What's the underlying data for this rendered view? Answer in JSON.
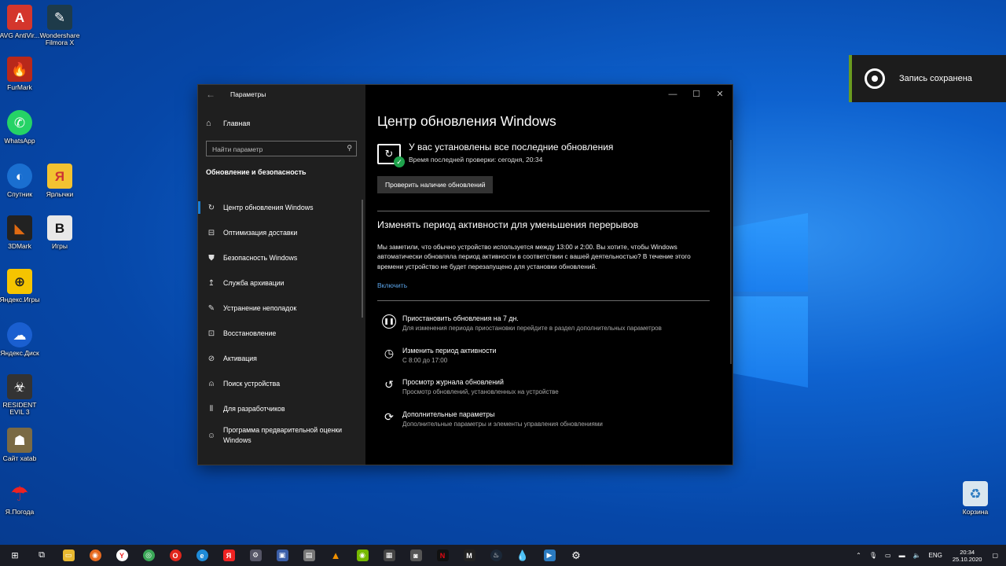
{
  "desktop_icons": [
    {
      "label": "AVG AntiVir...",
      "icon": "avg-icon",
      "color": "#d4362c"
    },
    {
      "label": "Wondershare Filmora X",
      "icon": "filmora-icon",
      "color": "#1e3b4a"
    },
    {
      "label": "FurMark",
      "icon": "furmark-icon",
      "color": "#b8281a"
    },
    {
      "label": "WhatsApp",
      "icon": "whatsapp-icon",
      "color": "#25d366"
    },
    {
      "label": "Спутник",
      "icon": "sputnik-icon",
      "color": "#1a6fd0"
    },
    {
      "label": "Ярлычки",
      "icon": "shortcuts-icon",
      "color": "#f2c231"
    },
    {
      "label": "3DMark",
      "icon": "3dmark-icon",
      "color": "#e06a12"
    },
    {
      "label": "Игры",
      "icon": "games-icon",
      "color": "#222"
    },
    {
      "label": "Яндекс.Игры",
      "icon": "yandex-games-icon",
      "color": "#f5c400"
    },
    {
      "label": "Яндекс.Диск",
      "icon": "yandex-disk-icon",
      "color": "#1a5fd0"
    },
    {
      "label": "RESIDENT EVIL 3",
      "icon": "re3-icon",
      "color": "#333"
    },
    {
      "label": "Сайт xatab",
      "icon": "xatab-icon",
      "color": "#7a6a44"
    },
    {
      "label": "Я.Погода",
      "icon": "weather-icon",
      "color": "#e22"
    },
    {
      "label": "Корзина",
      "icon": "recycle-bin-icon",
      "color": "#d9e6ef"
    }
  ],
  "toast": {
    "text": "Запись сохранена",
    "icon": "record-icon"
  },
  "window": {
    "title": "Параметры",
    "controls": {
      "minimize": "—",
      "maximize": "☐",
      "close": "✕"
    }
  },
  "sidebar": {
    "home": "Главная",
    "search_placeholder": "Найти параметр",
    "section": "Обновление и безопасность",
    "items": [
      {
        "label": "Центр обновления Windows",
        "icon": "sync-icon"
      },
      {
        "label": "Оптимизация доставки",
        "icon": "delivery-icon"
      },
      {
        "label": "Безопасность Windows",
        "icon": "shield-icon"
      },
      {
        "label": "Служба архивации",
        "icon": "backup-icon"
      },
      {
        "label": "Устранение неполадок",
        "icon": "wrench-icon"
      },
      {
        "label": "Восстановление",
        "icon": "recovery-icon"
      },
      {
        "label": "Активация",
        "icon": "activation-icon"
      },
      {
        "label": "Поиск устройства",
        "icon": "find-device-icon"
      },
      {
        "label": "Для разработчиков",
        "icon": "developer-icon"
      },
      {
        "label": "Программа предварительной оценки Windows",
        "icon": "insider-icon"
      }
    ]
  },
  "main": {
    "title": "Центр обновления Windows",
    "status_title": "У вас установлены все последние обновления",
    "status_sub": "Время последней проверки: сегодня, 20:34",
    "check_button": "Проверить наличие обновлений",
    "active_hours_title": "Изменять период активности для уменьшения перерывов",
    "active_hours_text": "Мы заметили, что обычно устройство используется между 13:00 и 2:00. Вы хотите, чтобы Windows автоматически обновляла период активности в соответствии с вашей деятельностью? В течение этого времени устройство не будет перезапущено для установки обновлений.",
    "enable_link": "Включить",
    "options": [
      {
        "title": "Приостановить обновления на 7 дн.",
        "sub": "Для изменения периода приостановки перейдите в раздел дополнительных параметров",
        "icon": "pause-icon"
      },
      {
        "title": "Изменить период активности",
        "sub": "С 8:00 до 17:00",
        "icon": "active-hours-icon"
      },
      {
        "title": "Просмотр журнала обновлений",
        "sub": "Просмотр обновлений, установленных на устройстве",
        "icon": "history-icon"
      },
      {
        "title": "Дополнительные параметры",
        "sub": "Дополнительные параметры и элементы управления обновлениями",
        "icon": "advanced-options-icon"
      }
    ]
  },
  "taskbar": {
    "language": "ENG",
    "time": "20:34",
    "date": "25.10.2020"
  }
}
